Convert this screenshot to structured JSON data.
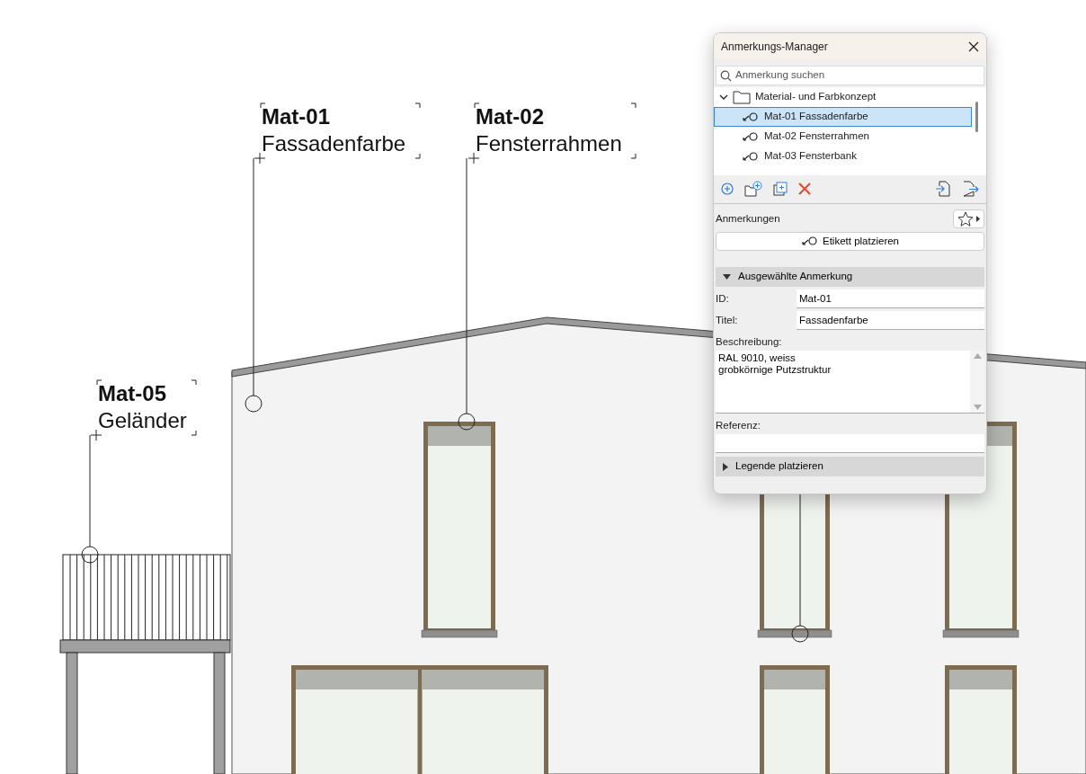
{
  "drawing": {
    "callouts": [
      {
        "id": "Mat-01",
        "title": "Fassadenfarbe"
      },
      {
        "id": "Mat-02",
        "title": "Fensterrahmen"
      },
      {
        "id": "Mat-05",
        "title": "Geländer"
      }
    ]
  },
  "panel": {
    "title": "Anmerkungs-Manager",
    "search": {
      "placeholder": "Anmerkung suchen"
    },
    "tree": [
      {
        "label": "Material- und Farbkonzept",
        "expanded": true,
        "children": [
          {
            "label": "Mat-01 Fassadenfarbe",
            "selected": true
          },
          {
            "label": "Mat-02 Fensterrahmen",
            "selected": false
          },
          {
            "label": "Mat-03 Fensterbank",
            "selected": false
          }
        ]
      }
    ],
    "annotations_label": "Anmerkungen",
    "place_tag_button": "Etikett platzieren",
    "sections": [
      {
        "title": "Ausgewählte Anmerkung",
        "expanded": true,
        "fields": [
          {
            "label": "ID:",
            "value": "Mat-01",
            "kind": "inline"
          },
          {
            "label": "Titel:",
            "value": "Fassadenfarbe",
            "kind": "inline"
          },
          {
            "label": "Beschreibung:",
            "value": "RAL 9010, weiss\ngrobkörnige Putzstruktur",
            "kind": "textarea"
          },
          {
            "label": "Referenz:",
            "kind": "stacked"
          }
        ]
      },
      {
        "title": "Legende platzieren",
        "expanded": false
      }
    ]
  }
}
